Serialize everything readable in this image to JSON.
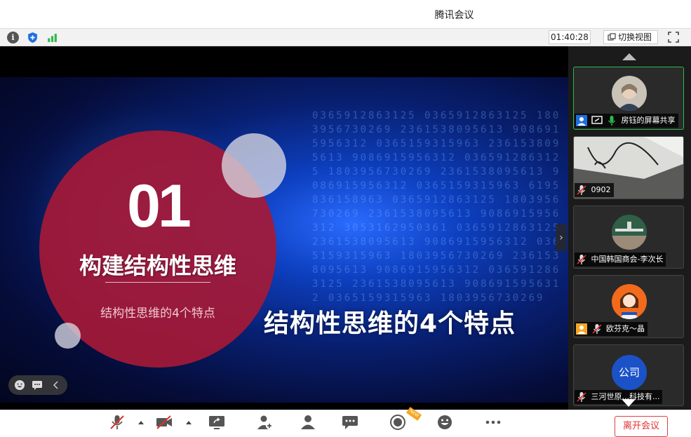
{
  "window": {
    "title": "腾讯会议"
  },
  "statusbar": {
    "timer": "01:40:28",
    "switch_view_label": "切换视图"
  },
  "slide": {
    "number": "01",
    "heading": "构建结构性思维",
    "subheading": "结构性思维的4个特点",
    "title": "结构性思维的4个特点",
    "digits": "0365912863125 0365912863125 1803956730269 2361538095613 9086915956312 0365159315963 2361538095613 9086915956312 0365912863125 1803956730269 2361538095613 9086915956312 0365159315963 6195836158963 0365912863125 1803956730269 2361538095613 9086915956312 3053162950361 0365912863125 2361538095613 9086915956312 0365159315963 1803956730269 2361538095613 9086915956312 0365912863125 2361538095613 9086915956312 0365159315963 1803956730269"
  },
  "participants": [
    {
      "name": "房钰的屏幕共享",
      "active": true,
      "kind": "photo"
    },
    {
      "name": "0902",
      "active": false,
      "kind": "video"
    },
    {
      "name": "中国韩国商会-李次长",
      "active": false,
      "kind": "photo"
    },
    {
      "name": "欧芬克～晶",
      "active": false,
      "kind": "cartoon"
    },
    {
      "name": "三河世原...科技有...",
      "active": false,
      "kind": "company",
      "avatar_text": "公司"
    }
  ],
  "toolbar": {
    "leave_label": "离开会议",
    "new_badge": "NEW"
  },
  "colors": {
    "accent_green": "#2db84d",
    "leave_red": "#e03030",
    "slide_red": "#a51937",
    "company_blue": "#1b52c8"
  }
}
